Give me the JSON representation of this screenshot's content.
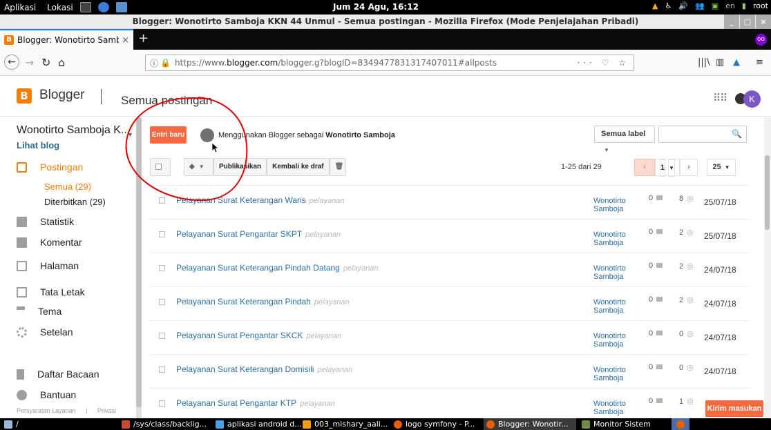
{
  "system": {
    "menu_apps": "Aplikasi",
    "menu_places": "Lokasi",
    "clock": "Jum 24 Agu, 16:12",
    "keyboard": "en",
    "user": "root"
  },
  "window": {
    "title": "Blogger: Wonotirto Samboja KKN 44 Unmul - Semua postingan - Mozilla Firefox (Mode Penjelajahan Pribadi)"
  },
  "browser": {
    "tab_title": "Blogger: Wonotirto Samb",
    "url_prefix": "https://www.",
    "url_host": "blogger.com",
    "url_path": "/blogger.g?blogID=8349477831317407011#allposts",
    "page_actions": "··· ♡ ☆"
  },
  "blogger": {
    "brand": "Blogger",
    "page_title": "Semua postingan",
    "avatar_letter": "K",
    "blog_title": "Wonotirto Samboja K...",
    "view_blog": "Lihat blog",
    "new_post": "Entri baru",
    "using_as_prefix": "Menggunakan Blogger sebagai",
    "using_as_name": "Wonotirto Samboja",
    "label_filter": "Semua label",
    "sidebar": {
      "posts": "Postingan",
      "all": "Semua (29)",
      "published": "Diterbitkan (29)",
      "stats": "Statistik",
      "comments": "Komentar",
      "pages": "Halaman",
      "layout": "Tata Letak",
      "theme": "Tema",
      "settings": "Setelan",
      "reading_list": "Daftar Bacaan",
      "help": "Bantuan",
      "terms": "Persyaratan Layanan",
      "privacy": "Privasi"
    },
    "toolbar": {
      "publish": "Publikasikan",
      "revert_draft": "Kembali ke draf"
    },
    "range": "1-25 dari 29",
    "page_number": "1",
    "per_page": "25",
    "feedback": "Kirim masukan",
    "posts": [
      {
        "title": "Pelayanan Surat Keterangan Waris",
        "label": "pelayanan",
        "author_first": "Wonotirto",
        "author_last": "Samboja",
        "comments": "0",
        "views": "8",
        "date": "25/07/18"
      },
      {
        "title": "Pelayanan Surat Pengantar SKPT",
        "label": "pelayanan",
        "author_first": "Wonotirto",
        "author_last": "Samboja",
        "comments": "0",
        "views": "2",
        "date": "25/07/18"
      },
      {
        "title": "Pelayanan Surat Keterangan Pindah Datang",
        "label": "pelayanan",
        "author_first": "Wonotirto",
        "author_last": "Samboja",
        "comments": "0",
        "views": "2",
        "date": "24/07/18"
      },
      {
        "title": "Pelayanan Surat Keterangan Pindah",
        "label": "pelayanan",
        "author_first": "Wonotirto",
        "author_last": "Samboja",
        "comments": "0",
        "views": "2",
        "date": "24/07/18"
      },
      {
        "title": "Pelayanan Surat Pengantar SKCK",
        "label": "pelayanan",
        "author_first": "Wonotirto",
        "author_last": "Samboja",
        "comments": "0",
        "views": "0",
        "date": "24/07/18"
      },
      {
        "title": "Pelayanan Surat Keterangan Domisili",
        "label": "pelayanan",
        "author_first": "Wonotirto",
        "author_last": "Samboja",
        "comments": "0",
        "views": "0",
        "date": "24/07/18"
      },
      {
        "title": "Pelayanan Surat Pengantar KTP",
        "label": "pelayanan",
        "author_first": "Wonotirto",
        "author_last": "Samboja",
        "comments": "0",
        "views": "1",
        "date": ""
      }
    ]
  },
  "taskbar": {
    "workspace": "/",
    "tasks": [
      "/sys/class/backlig...",
      "aplikasi android d...",
      "003_mishary_aali...",
      "logo symfony - P...",
      "Blogger: Wonotir...",
      "Monitor Sistem"
    ]
  },
  "colors": {
    "blogger_orange": "#f57d00",
    "new_post_button": "#f4693f",
    "link_blue": "#2a6ea3",
    "annotation_red": "#e00000"
  }
}
